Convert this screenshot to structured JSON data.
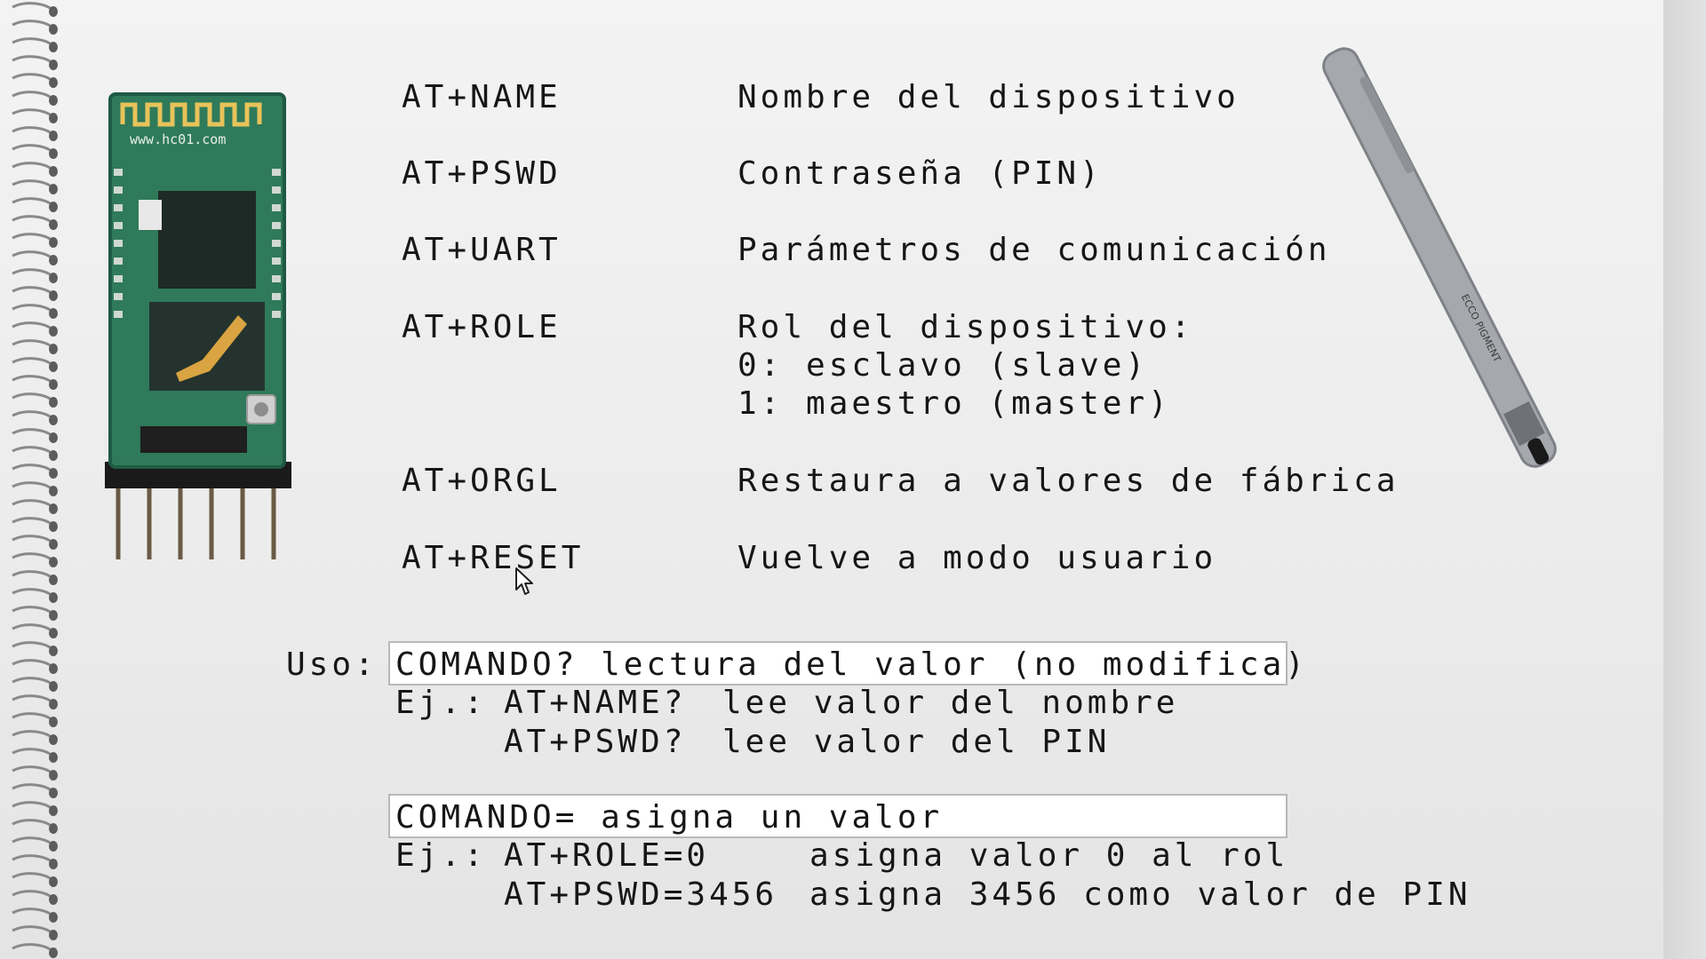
{
  "commands": [
    {
      "name": "AT+NAME",
      "desc": [
        "Nombre del dispositivo"
      ]
    },
    {
      "name": "AT+PSWD",
      "desc": [
        "Contraseña (PIN)"
      ]
    },
    {
      "name": "AT+UART",
      "desc": [
        "Parámetros de comunicación"
      ]
    },
    {
      "name": "AT+ROLE",
      "desc": [
        "Rol del dispositivo:",
        "0: esclavo (slave)",
        "1: maestro (master)"
      ]
    },
    {
      "name": "AT+ORGL",
      "desc": [
        "Restaura a valores de fábrica"
      ]
    },
    {
      "name": "AT+RESET",
      "desc": [
        "Vuelve a modo usuario"
      ]
    }
  ],
  "usage": {
    "label": "Uso:",
    "read": {
      "box": "COMANDO? lectura del valor (no modifica)",
      "ej_label": "Ej.:",
      "examples": [
        {
          "cmd": "AT+NAME?",
          "text": "lee valor del nombre"
        },
        {
          "cmd": "AT+PSWD?",
          "text": "lee valor del PIN"
        }
      ]
    },
    "write": {
      "box": "COMANDO= asigna un valor",
      "ej_label": "Ej.:",
      "examples": [
        {
          "cmd": "AT+ROLE=0",
          "text": "asigna valor 0 al rol"
        },
        {
          "cmd": "AT+PSWD=3456",
          "text": "asigna 3456 como valor de PIN"
        }
      ]
    }
  },
  "module_label": "www.hc01.com",
  "pen_label": "ECCO PIGMENT",
  "colors": {
    "pcb": "#2f7a5a",
    "pcb_edge": "#1f5a44",
    "pen": "#a5a8ad",
    "paper": "#eeeeee"
  }
}
